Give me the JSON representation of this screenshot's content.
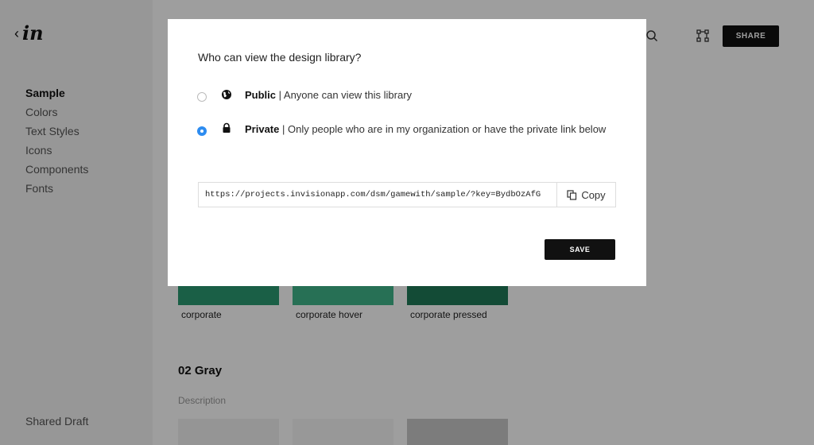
{
  "sidebar": {
    "logo_text": "in",
    "back_glyph": "‹",
    "items": [
      {
        "label": "Sample",
        "active": true
      },
      {
        "label": "Colors"
      },
      {
        "label": "Text Styles"
      },
      {
        "label": "Icons"
      },
      {
        "label": "Components"
      },
      {
        "label": "Fonts"
      }
    ],
    "footer": "Shared Draft"
  },
  "header": {
    "share_label": "SHARE",
    "icons": [
      "search-icon",
      "prototype-icon"
    ]
  },
  "colors_section": {
    "swatches": [
      {
        "label": "corporate",
        "color": "#2a9a72"
      },
      {
        "label": "corporate hover",
        "color": "#3fb58a"
      },
      {
        "label": "corporate pressed",
        "color": "#1f7a58"
      }
    ]
  },
  "gray_section": {
    "title": "02 Gray",
    "description": "Description",
    "swatch_colors": [
      "#f0f0f0",
      "#f5f5f5",
      "#c8c8c8"
    ]
  },
  "modal": {
    "question": "Who can view the design library?",
    "options": [
      {
        "title": "Public",
        "separator": " | ",
        "description": "Anyone can view this library",
        "icon": "globe-icon",
        "selected": false
      },
      {
        "title": "Private",
        "separator": " | ",
        "description": "Only people who are in my organization or have the private link below",
        "icon": "lock-icon",
        "selected": true
      }
    ],
    "link_url": "https://projects.invisionapp.com/dsm/gamewith/sample/?key=BydbOzAfG",
    "copy_label": "Copy",
    "save_label": "SAVE"
  },
  "colors": {
    "accent": "#2d8cf0",
    "overlay": "rgba(0,0,0,0.38)"
  }
}
